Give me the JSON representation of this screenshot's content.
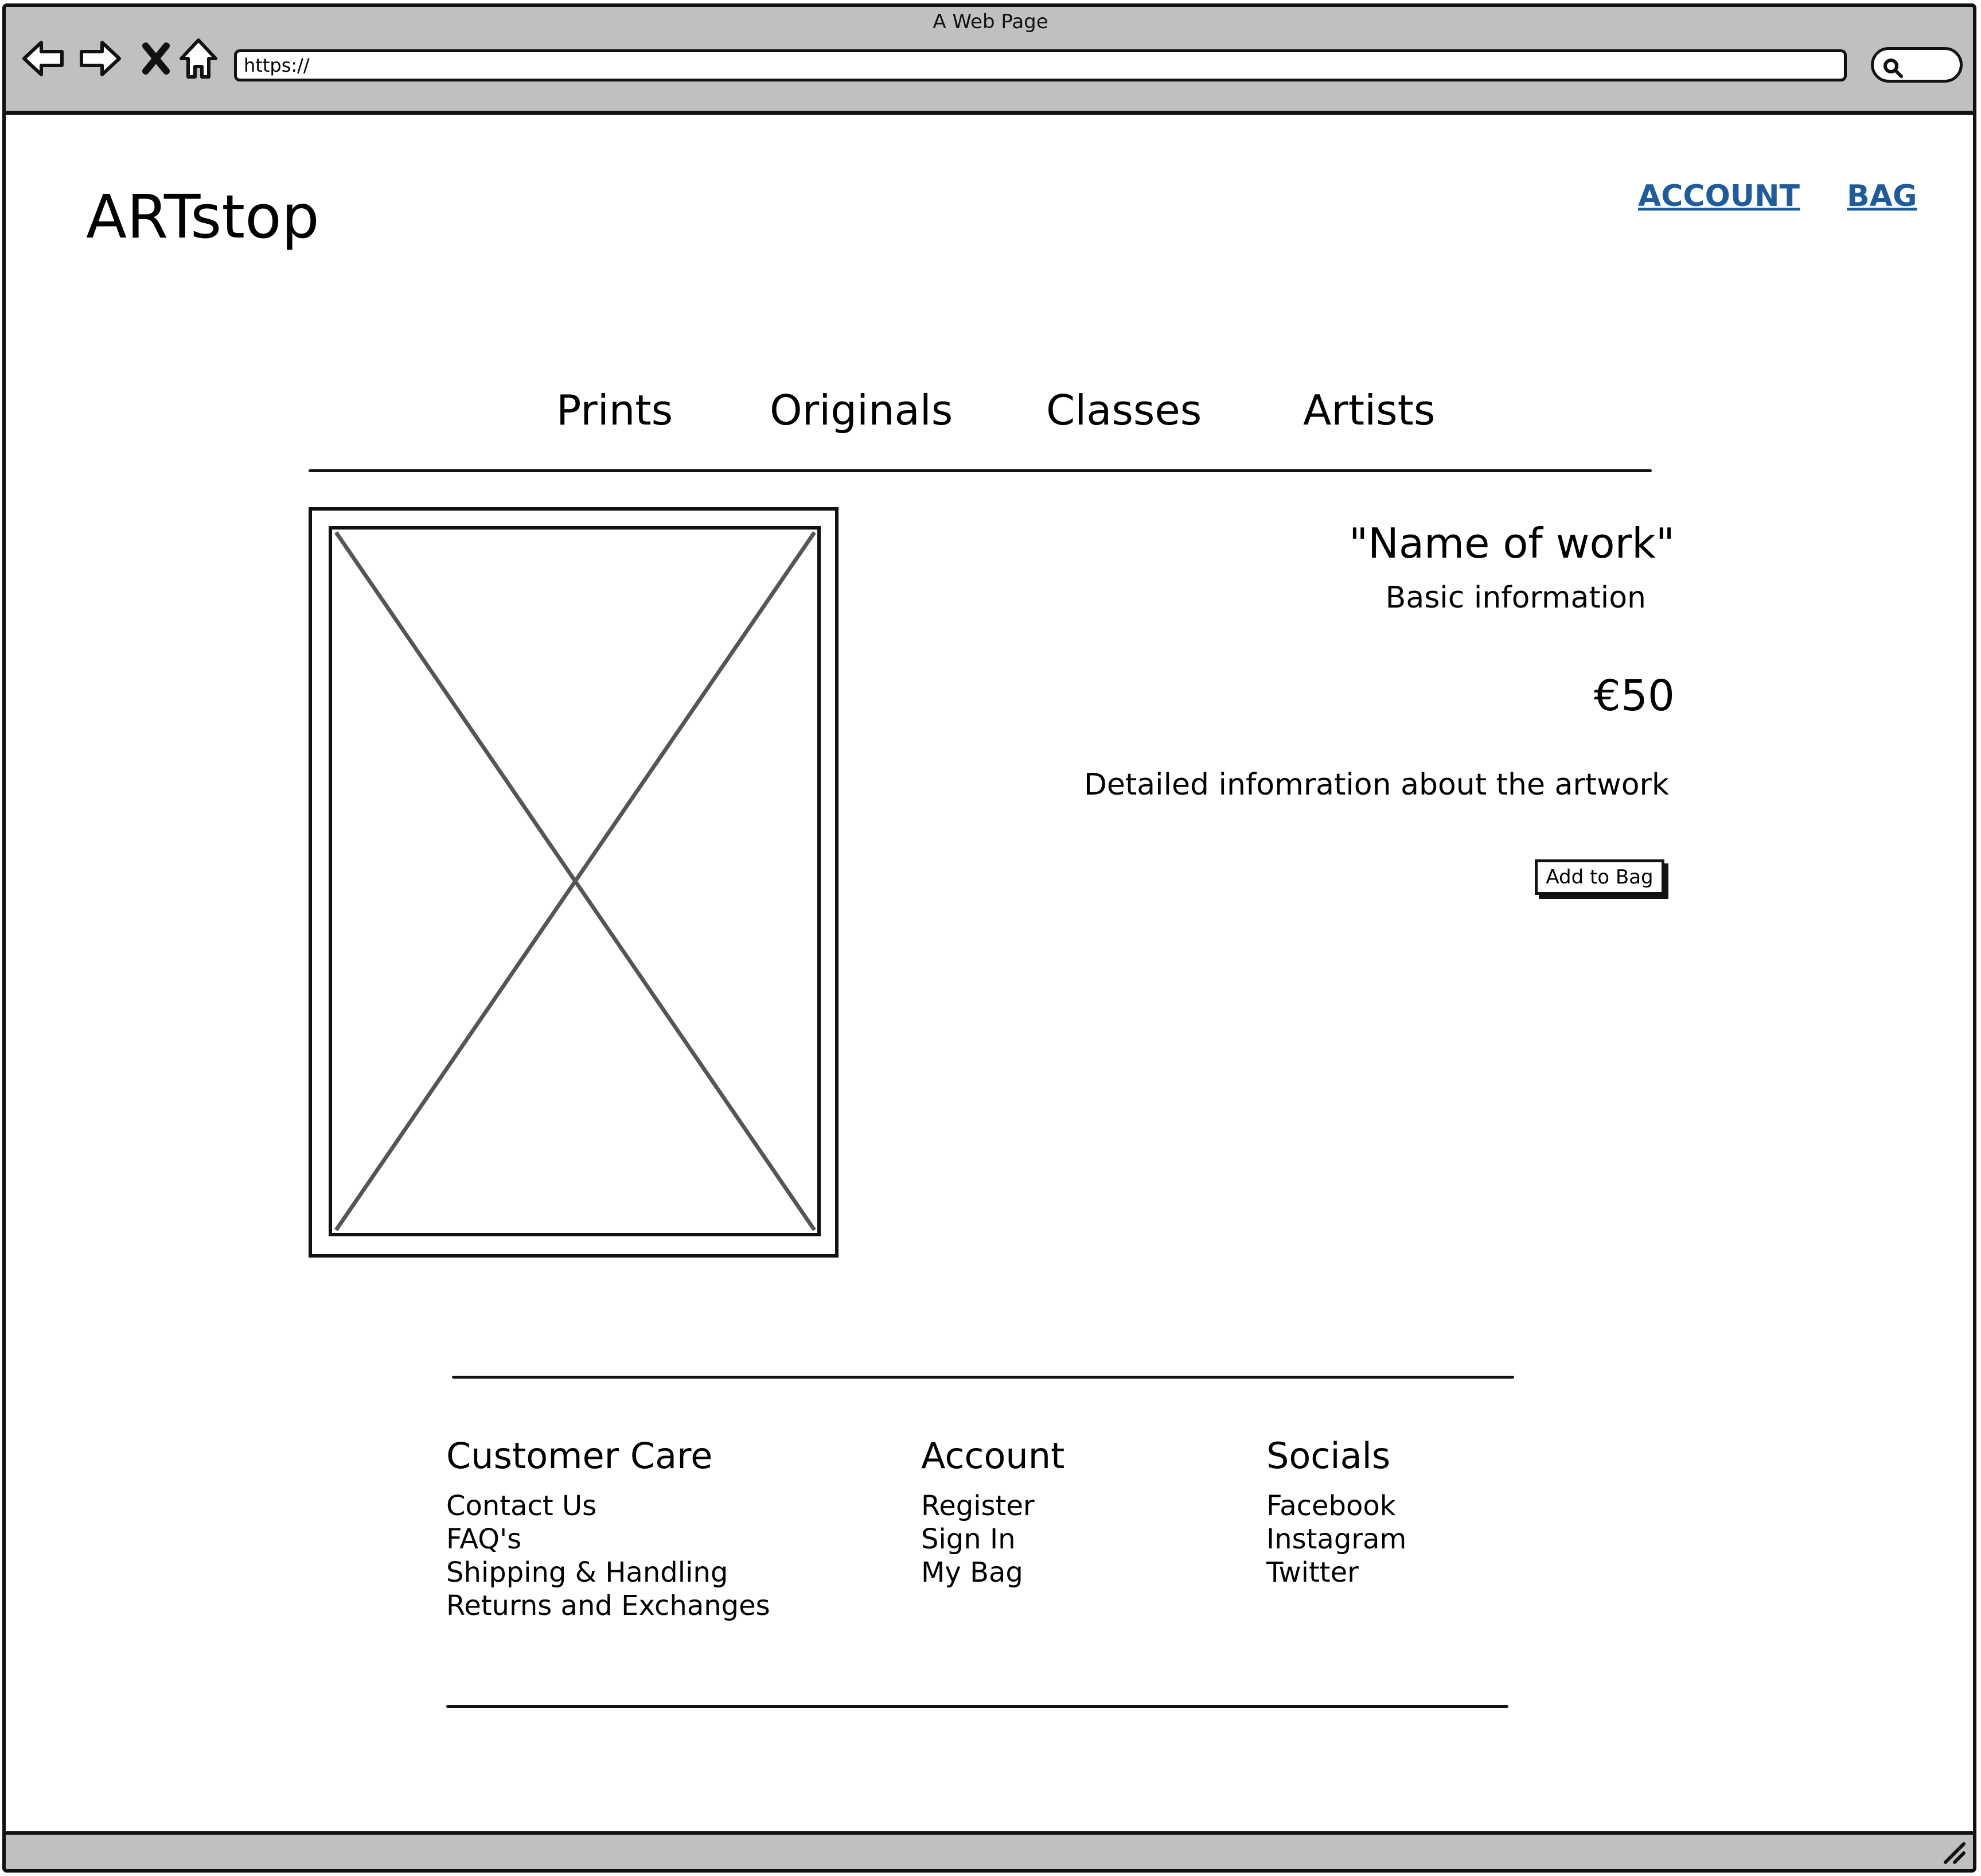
{
  "browser": {
    "window_title": "A Web Page",
    "address": "https://"
  },
  "header": {
    "logo": "ARTstop",
    "links": {
      "account": "ACCOUNT",
      "bag": "BAG"
    },
    "link_color": "#1f5c99"
  },
  "main_nav": [
    "Prints",
    "Originals",
    "Classes",
    "Artists"
  ],
  "product": {
    "image_icon": "image-placeholder-icon",
    "title": "\"Name of work\"",
    "basic_info": "Basic information",
    "price": "€50",
    "detailed_info": "Detailed infomration about the artwork",
    "add_to_bag": "Add to Bag"
  },
  "footer": {
    "customer_care": {
      "heading": "Customer Care",
      "links": [
        "Contact Us",
        "FAQ's",
        "Shipping & Handling",
        "Returns and Exchanges"
      ]
    },
    "account": {
      "heading": "Account",
      "links": [
        "Register",
        "Sign In",
        "My Bag"
      ]
    },
    "socials": {
      "heading": "Socials",
      "links": [
        "Facebook",
        "Instagram",
        "Twitter"
      ]
    }
  }
}
